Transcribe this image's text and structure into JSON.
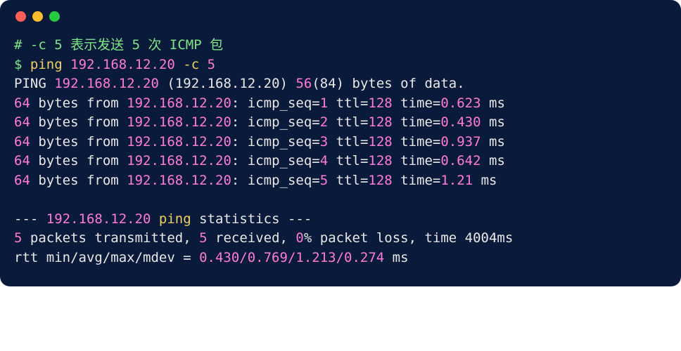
{
  "titlebar": {
    "red": "close-dot",
    "yellow": "minimize-dot",
    "green": "zoom-dot"
  },
  "comment": {
    "hash": "#",
    "flag": "-c 5",
    "note1": " 表示发送 ",
    "five": "5",
    "note2": " 次 ",
    "icmp": "ICMP",
    "note3": " 包"
  },
  "cmd": {
    "prompt": "$",
    "name": "ping",
    "target": "192.168.12.20",
    "flag": "-c",
    "count": "5"
  },
  "header": {
    "label": "PING",
    "ip": "192.168.12.20",
    "paren_ip": "(192.168.12.20)",
    "size": "56",
    "rest": "(84) bytes of data."
  },
  "replies": [
    {
      "bytes": "64",
      "ip": "192.168.12.20",
      "seq": "1",
      "ttl": "128",
      "time": "0.623"
    },
    {
      "bytes": "64",
      "ip": "192.168.12.20",
      "seq": "2",
      "ttl": "128",
      "time": "0.430"
    },
    {
      "bytes": "64",
      "ip": "192.168.12.20",
      "seq": "3",
      "ttl": "128",
      "time": "0.937"
    },
    {
      "bytes": "64",
      "ip": "192.168.12.20",
      "seq": "4",
      "ttl": "128",
      "time": "0.642"
    },
    {
      "bytes": "64",
      "ip": "192.168.12.20",
      "seq": "5",
      "ttl": "128",
      "time": "1.21"
    }
  ],
  "reply_static": {
    "bytes_from": " bytes from ",
    "colon_seq": ": icmp_seq=",
    "ttl_eq": " ttl=",
    "time_eq": " time=",
    "ms": " ms"
  },
  "stats_hdr": {
    "dashes1": "--- ",
    "ip": "192.168.12.20",
    "ping_word": " ping",
    "rest": " statistics ---"
  },
  "stats1": {
    "tx": "5",
    "t1": " packets transmitted, ",
    "rx": "5",
    "t2": " received, ",
    "loss": "0",
    "t3": "% packet loss, time ",
    "time": "4004ms"
  },
  "stats2": {
    "label": "rtt min/avg/max/mdev = ",
    "vals": "0.430/0.769/1.213/0.274",
    "ms": " ms"
  }
}
